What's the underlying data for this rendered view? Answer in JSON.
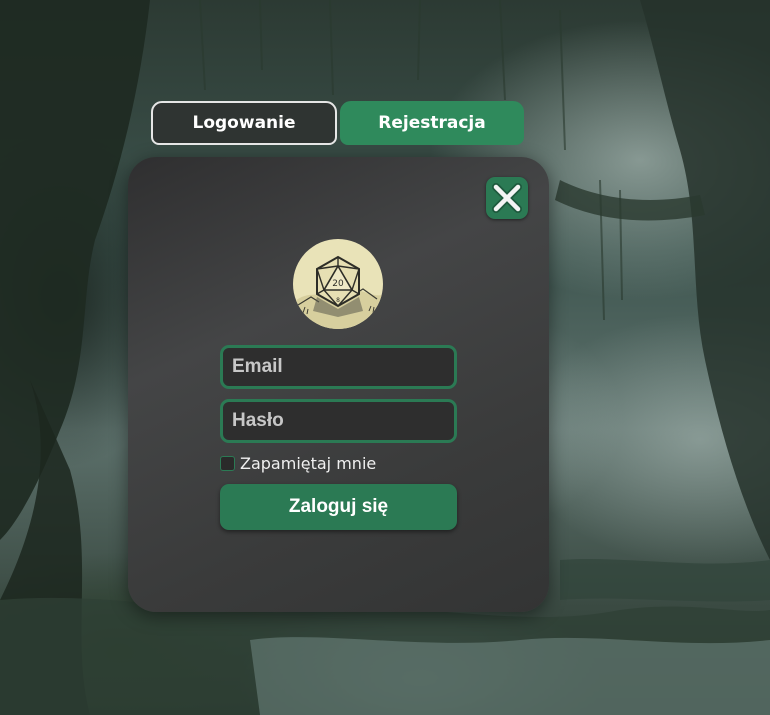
{
  "tabs": {
    "login_label": "Logowanie",
    "register_label": "Rejestracja",
    "active": "login"
  },
  "form": {
    "email_placeholder": "Email",
    "password_placeholder": "Hasło",
    "remember_label": "Zapamiętaj mnie",
    "remember_checked": false,
    "submit_label": "Zaloguj się"
  },
  "icons": {
    "close": "close-icon",
    "logo": "d20-dice-logo"
  },
  "logo": {
    "die_number": "20",
    "die_number_bottom": "8"
  },
  "colors": {
    "accent": "#2b7a54",
    "tab_register": "#2f8a5c",
    "panel": "#3c3d3d",
    "logo_bg": "#e9e3b8"
  }
}
